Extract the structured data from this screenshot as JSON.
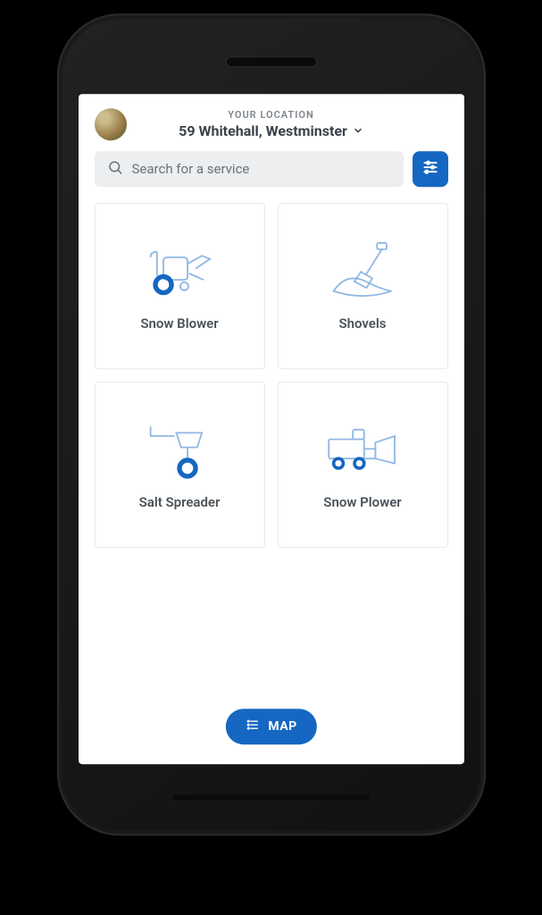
{
  "header": {
    "eyebrow": "YOUR LOCATION",
    "address": "59 Whitehall, Westminster"
  },
  "search": {
    "placeholder": "Search for a service"
  },
  "services": [
    {
      "label": "Snow Blower"
    },
    {
      "label": "Shovels"
    },
    {
      "label": "Salt Spreader"
    },
    {
      "label": "Snow Plower"
    }
  ],
  "map_button": "MAP",
  "colors": {
    "primary": "#1567c1",
    "border": "#e6e9ec",
    "muted": "#7e858b",
    "field_bg": "#eceeef",
    "text": "#4b5258"
  }
}
